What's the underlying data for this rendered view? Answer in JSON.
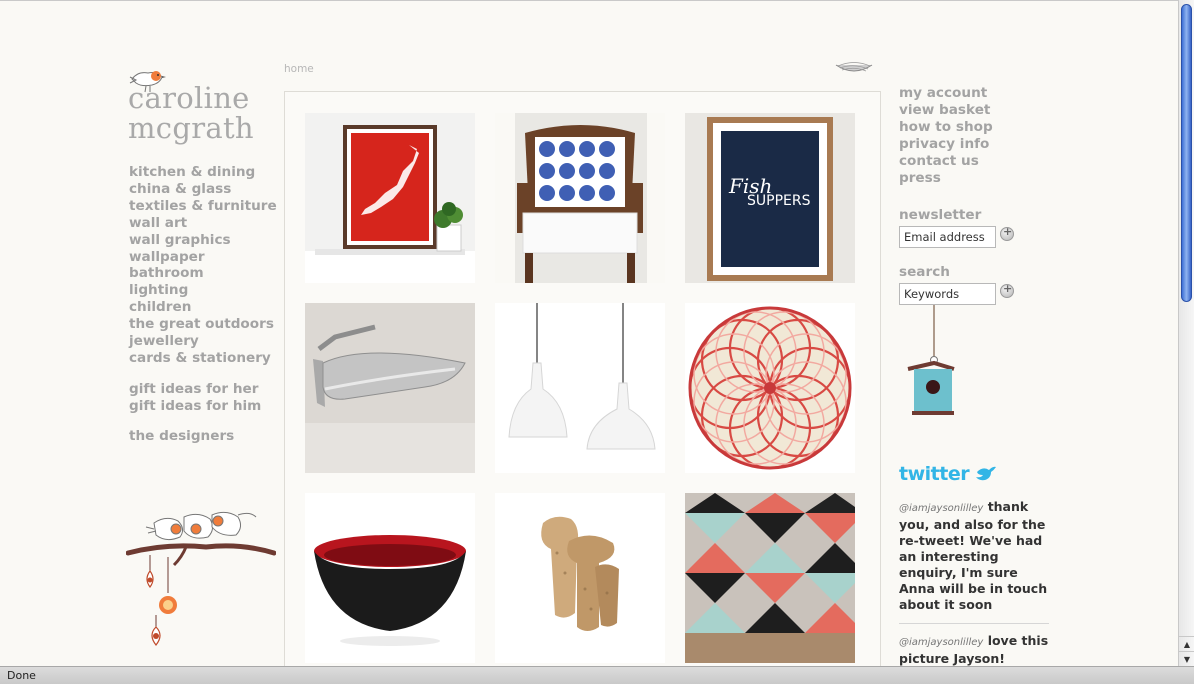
{
  "brand": {
    "line1": "caroline",
    "line2": "mcgrath"
  },
  "breadcrumb": "home",
  "nav": {
    "categories": [
      "kitchen & dining",
      "china & glass",
      "textiles & furniture",
      "wall art",
      "wall graphics",
      "wallpaper",
      "bathroom",
      "lighting",
      "children",
      "the great outdoors",
      "jewellery",
      "cards & stationery"
    ],
    "gifts": [
      "gift ideas for her",
      "gift ideas for him"
    ],
    "designers": "the designers"
  },
  "account_links": [
    "my account",
    "view basket",
    "how to shop",
    "privacy info",
    "contact us",
    "press"
  ],
  "newsletter": {
    "label": "newsletter",
    "placeholder": "Email address"
  },
  "search": {
    "label": "search",
    "placeholder": "Keywords"
  },
  "twitter": {
    "logo": "twitter",
    "tweets": [
      {
        "handle": "@iamjaysonlilley",
        "text": "thank you, and also for the re-tweet! We've had an interesting enquiry, I'm sure Anna will be in touch about it soon"
      },
      {
        "handle": "@iamjaysonlilley",
        "text": "love this picture Jayson!"
      }
    ]
  },
  "products": [
    {
      "name": "japan-map-print",
      "bg": "#ffffff"
    },
    {
      "name": "blue-dot-cushion-chair",
      "bg": "#ffffff"
    },
    {
      "name": "fish-suppers-print",
      "bg": "#ffffff",
      "text1": "Fish",
      "text2": "SUPPERS"
    },
    {
      "name": "folding-shower-seat",
      "bg": "#d9d5d0"
    },
    {
      "name": "white-pendant-lights",
      "bg": "#ffffff"
    },
    {
      "name": "red-spirograph-rug",
      "bg": "#ffffff"
    },
    {
      "name": "red-black-bowl",
      "bg": "#ffffff"
    },
    {
      "name": "cork-stools",
      "bg": "#ffffff"
    },
    {
      "name": "triangle-wallpaper",
      "bg": "#ffffff"
    }
  ],
  "status": "Done",
  "colors": {
    "accent_orange": "#f07c3b",
    "twitter_blue": "#32b5e6",
    "nav_grey": "#a3a3a3"
  }
}
